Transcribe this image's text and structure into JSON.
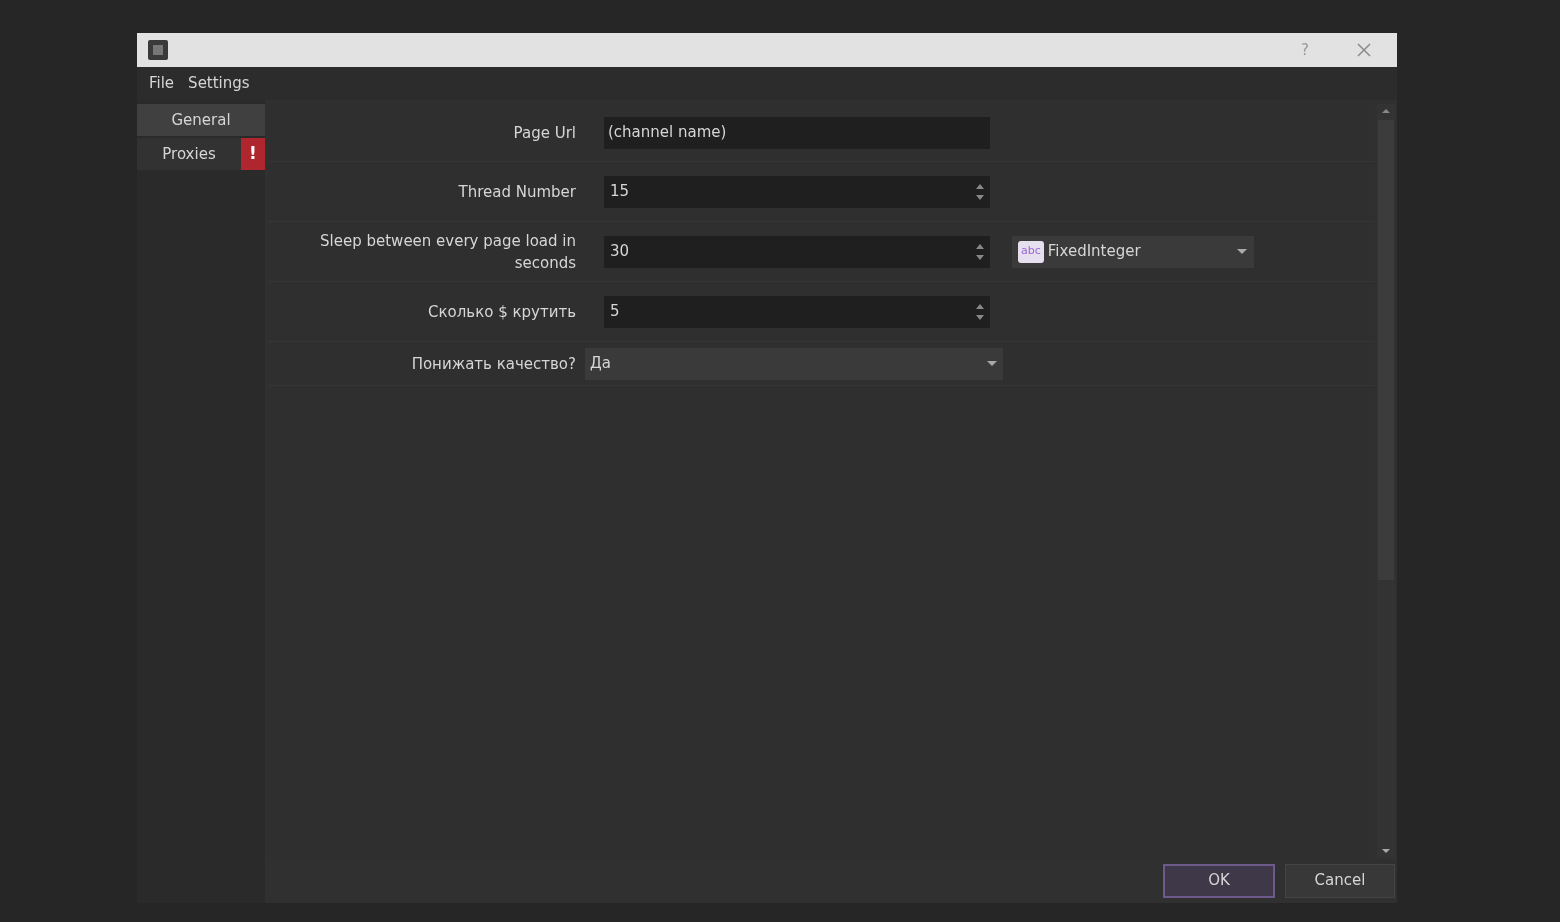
{
  "window": {
    "help_label": "?"
  },
  "menu": [
    "File",
    "Settings"
  ],
  "sidebar": {
    "items": [
      {
        "label": "General",
        "selected": true,
        "error": false
      },
      {
        "label": "Proxies",
        "selected": false,
        "error": true,
        "badge": "!"
      }
    ]
  },
  "form": {
    "rows": [
      {
        "label": "Page Url",
        "kind": "text",
        "value": "(channel name)"
      },
      {
        "label": "Thread Number",
        "kind": "spin",
        "value": "15"
      },
      {
        "label": "Sleep between every page load in seconds",
        "kind": "spin",
        "value": "30",
        "extra": {
          "badge": "abc",
          "value": "FixedInteger"
        }
      },
      {
        "label": "Сколько $ крутить",
        "kind": "spin",
        "value": "5"
      },
      {
        "label": "Понижать качество?",
        "kind": "select",
        "value": "Да"
      }
    ]
  },
  "buttons": [
    {
      "label": "OK",
      "default": true
    },
    {
      "label": "Cancel",
      "default": false
    }
  ]
}
